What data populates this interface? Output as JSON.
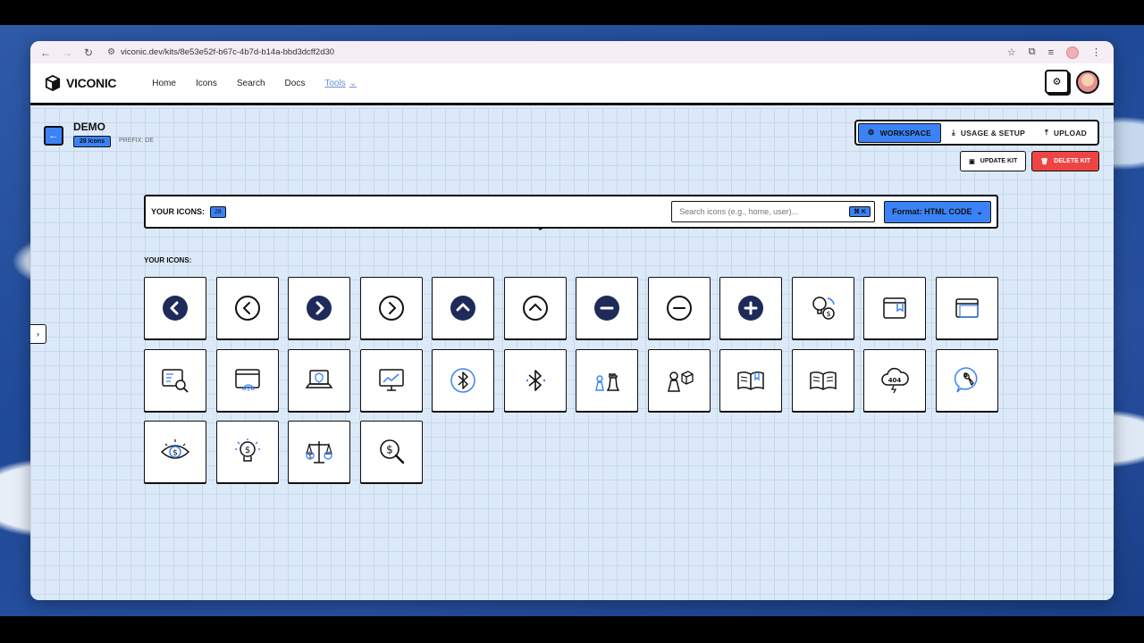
{
  "browser": {
    "url": "viconic.dev/kits/8e53e52f-b67c-4b7d-b14a-bbd3dcff2d30"
  },
  "header": {
    "logo": "VICONIC",
    "nav": [
      {
        "label": "Home"
      },
      {
        "label": "Icons"
      },
      {
        "label": "Search"
      },
      {
        "label": "Docs"
      },
      {
        "label": "Tools"
      }
    ]
  },
  "kit": {
    "title": "DEMO",
    "badge": "28 Icons",
    "prefix": "PREFIX: DE"
  },
  "tabs": [
    {
      "label": "WORKSPACE",
      "selected": true
    },
    {
      "label": "USAGE & SETUP",
      "selected": false
    },
    {
      "label": "UPLOAD",
      "selected": false
    }
  ],
  "actions": {
    "update": "UPDATE KIT",
    "delete": "DELETE KIT"
  },
  "toolbar": {
    "label": "YOUR ICONS:",
    "count": "28",
    "search_placeholder": "Search icons (e.g., home, user)...",
    "shortcut": "⌘ K",
    "format": "Format: HTML CODE"
  },
  "section_label": "YOUR ICONS:",
  "colors": {
    "accent": "#3b82f6",
    "danger": "#ef4444",
    "background": "#dce9f8"
  },
  "icons": [
    "chevron-left-filled-icon",
    "chevron-left-outline-icon",
    "chevron-right-filled-icon",
    "chevron-right-outline-icon",
    "chevron-up-filled-icon",
    "chevron-up-outline-icon",
    "minus-filled-icon",
    "minus-outline-icon",
    "plus-filled-icon",
    "idea-money-icon",
    "browser-window-bookmark-icon",
    "browser-window-icon",
    "user-profile-search-icon",
    "browser-fingerprint-icon",
    "laptop-shield-icon",
    "monitor-chart-icon",
    "bluetooth-circle-icon",
    "bluetooth-icon",
    "chess-pieces-icon",
    "chess-pawn-cube-icon",
    "open-book-bookmark-icon",
    "open-book-icon",
    "cloud-404-icon",
    "wrench-bubble-icon",
    "eye-money-icon",
    "lightbulb-money-icon",
    "scale-money-icon",
    "search-money-icon"
  ]
}
